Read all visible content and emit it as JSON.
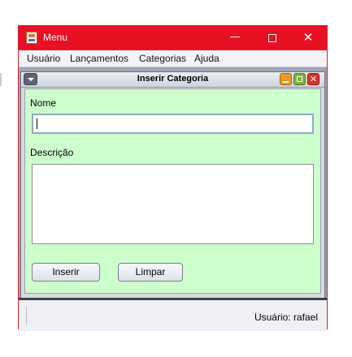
{
  "window": {
    "title": "Menu",
    "min_glyph": "—",
    "close_glyph": "✕"
  },
  "menubar": {
    "items": [
      "Usuário",
      "Lançamentos",
      "Categorias",
      "Ajuda"
    ]
  },
  "internal_frame": {
    "title": "Inserir Categoria",
    "close_glyph": "✕",
    "form": {
      "nome_label": "Nome",
      "nome_value": "",
      "descricao_label": "Descrição",
      "descricao_value": "",
      "insert_button": "Inserir",
      "clear_button": "Limpar"
    }
  },
  "status_bar": {
    "user_text": "Usuário: rafael"
  },
  "colors": {
    "title_bar": "#e81123",
    "form_background": "#ccffcc"
  }
}
